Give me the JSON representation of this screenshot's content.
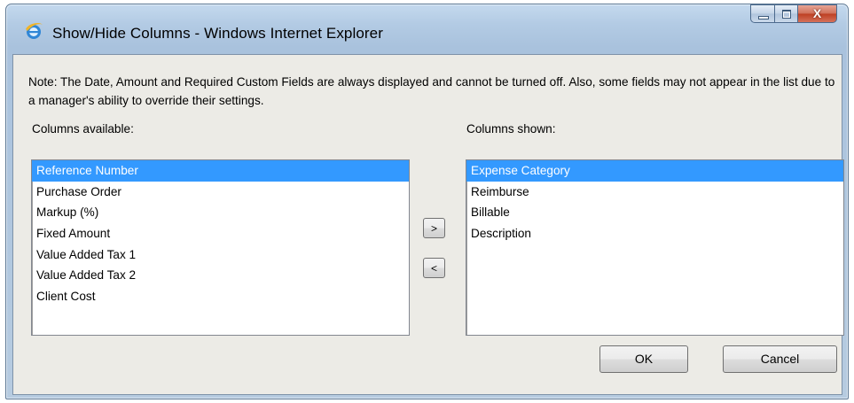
{
  "window": {
    "title": "Show/Hide Columns - Windows Internet Explorer",
    "close_glyph": "X"
  },
  "note": "Note: The Date, Amount and Required Custom Fields are always displayed and cannot be turned off. Also, some fields may not appear in the list due to a manager's ability to override their settings.",
  "available": {
    "label": "Columns available:",
    "items": [
      "Reference Number",
      "Purchase Order",
      "Markup (%)",
      "Fixed Amount",
      "Value Added Tax 1",
      "Value Added Tax 2",
      "Client Cost"
    ],
    "selected": "Reference Number"
  },
  "shown": {
    "label": "Columns shown:",
    "items": [
      "Expense Category",
      "Reimburse",
      "Billable",
      "Description"
    ],
    "selected": "Expense Category"
  },
  "buttons": {
    "add": ">",
    "remove": "<",
    "ok": "OK",
    "cancel": "Cancel"
  },
  "icons": {
    "window_icon": "internet-explorer-icon",
    "minimize": "minimize-icon",
    "maximize": "maximize-icon",
    "close": "close-icon"
  }
}
